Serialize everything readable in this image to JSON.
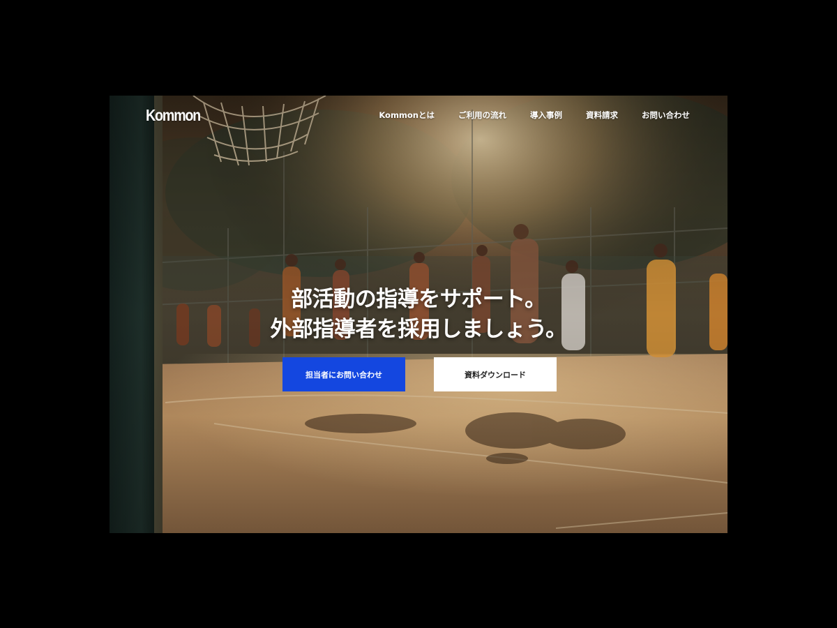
{
  "brand": {
    "logo": "Kommon"
  },
  "nav": {
    "items": [
      {
        "label": "Kommonとは"
      },
      {
        "label": "ご利用の流れ"
      },
      {
        "label": "導入事例"
      },
      {
        "label": "資料請求"
      },
      {
        "label": "お問い合わせ"
      }
    ]
  },
  "hero": {
    "headline_line1": "部活動の指導をサポート。",
    "headline_line2": "外部指導者を採用しましょう。",
    "background_description_icon": "basketball-court-photo"
  },
  "cta": {
    "primary_label": "担当者にお問い合わせ",
    "secondary_label": "資料ダウンロード"
  },
  "colors": {
    "primary_button": "#1447e0",
    "secondary_button": "#ffffff",
    "page_background": "#000000"
  }
}
